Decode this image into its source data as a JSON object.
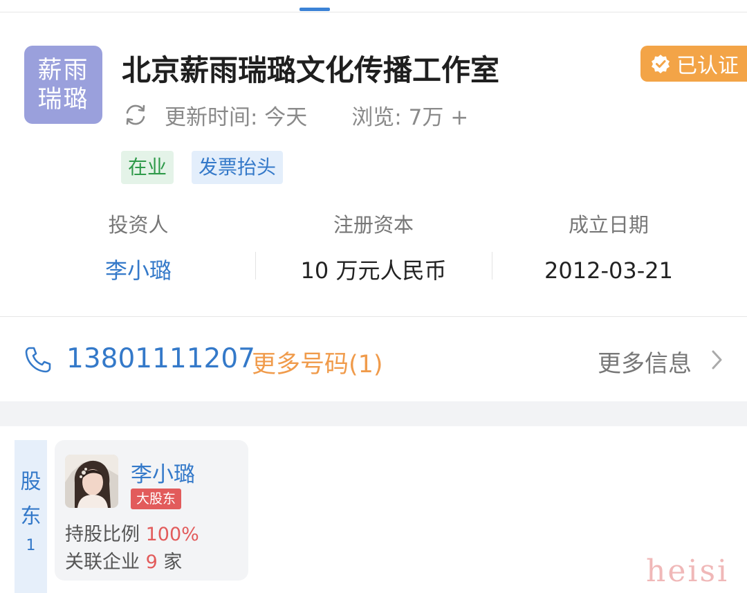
{
  "company": {
    "logo_text": "薪雨瑞璐",
    "name": "北京薪雨瑞璐文化传播工作室",
    "verified_label": "已认证",
    "update_label": "更新时间: 今天",
    "views_label": "浏览: 7万 +",
    "tags": [
      "在业",
      "发票抬头"
    ]
  },
  "stats": [
    {
      "label": "投资人",
      "value": "李小璐"
    },
    {
      "label": "注册资本",
      "value": "10 万元人民币"
    },
    {
      "label": "成立日期",
      "value": "2012-03-21"
    }
  ],
  "contact": {
    "phone": "13801111207",
    "more_numbers": "更多号码(1)",
    "more_info": "更多信息"
  },
  "shareholders": {
    "section_title": "股东",
    "count": "1",
    "items": [
      {
        "name": "李小璐",
        "badge": "大股东",
        "ratio_label": "持股比例",
        "ratio_value": "100%",
        "related_label": "关联企业",
        "related_count": "9",
        "related_unit": "家"
      }
    ]
  },
  "watermark": "heisi",
  "colors": {
    "accent_blue": "#3479c9",
    "badge_orange": "#f3a447",
    "logo_purple": "#9aa0dc",
    "highlight_red": "#e25b5b",
    "orange_link": "#f09b4b"
  }
}
